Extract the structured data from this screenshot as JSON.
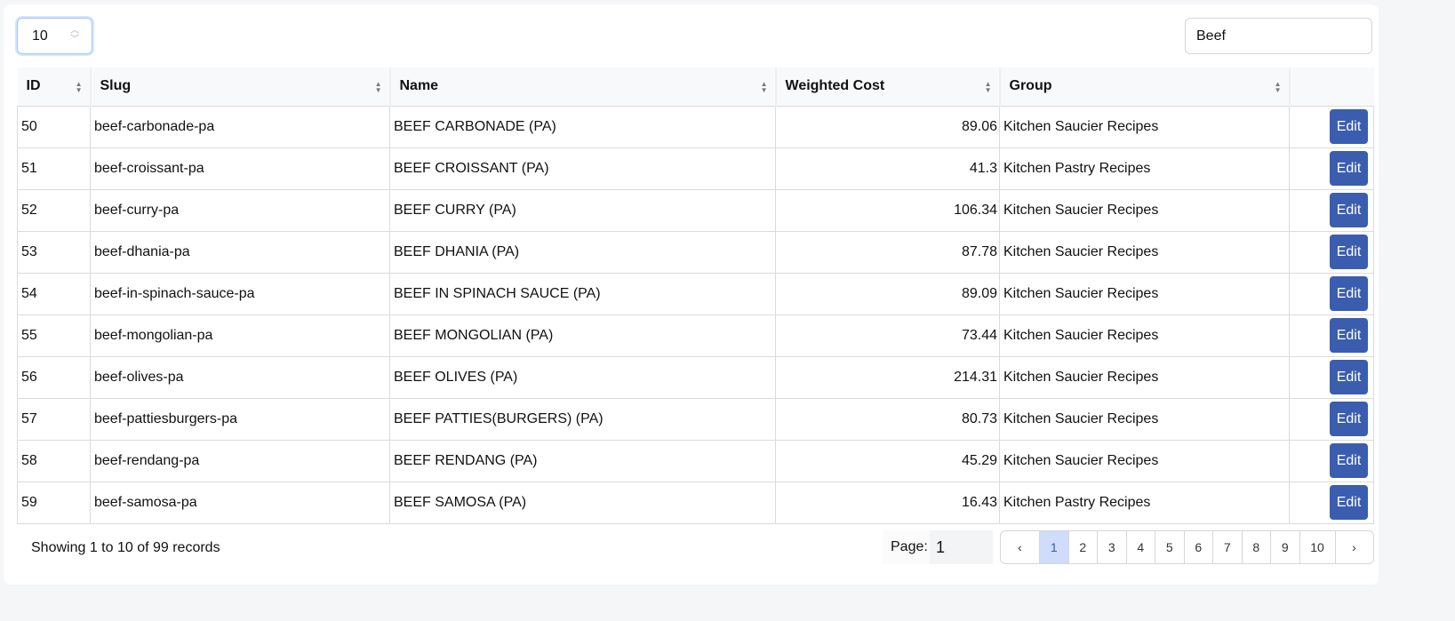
{
  "controls": {
    "per_page": "10",
    "search_value": "Beef"
  },
  "table": {
    "columns": [
      "ID",
      "Slug",
      "Name",
      "Weighted Cost",
      "Group",
      ""
    ],
    "rows": [
      {
        "id": "50",
        "slug": "beef-carbonade-pa",
        "name": "BEEF CARBONADE (PA)",
        "cost": "89.06",
        "group": "Kitchen Saucier Recipes"
      },
      {
        "id": "51",
        "slug": "beef-croissant-pa",
        "name": "BEEF CROISSANT (PA)",
        "cost": "41.3",
        "group": "Kitchen Pastry Recipes"
      },
      {
        "id": "52",
        "slug": "beef-curry-pa",
        "name": "BEEF CURRY (PA)",
        "cost": "106.34",
        "group": "Kitchen Saucier Recipes"
      },
      {
        "id": "53",
        "slug": "beef-dhania-pa",
        "name": "BEEF DHANIA (PA)",
        "cost": "87.78",
        "group": "Kitchen Saucier Recipes"
      },
      {
        "id": "54",
        "slug": "beef-in-spinach-sauce-pa",
        "name": "BEEF IN SPINACH SAUCE (PA)",
        "cost": "89.09",
        "group": "Kitchen Saucier Recipes"
      },
      {
        "id": "55",
        "slug": "beef-mongolian-pa",
        "name": "BEEF MONGOLIAN (PA)",
        "cost": "73.44",
        "group": "Kitchen Saucier Recipes"
      },
      {
        "id": "56",
        "slug": "beef-olives-pa",
        "name": "BEEF OLIVES (PA)",
        "cost": "214.31",
        "group": "Kitchen Saucier Recipes"
      },
      {
        "id": "57",
        "slug": "beef-pattiesburgers-pa",
        "name": "BEEF PATTIES(BURGERS) (PA)",
        "cost": "80.73",
        "group": "Kitchen Saucier Recipes"
      },
      {
        "id": "58",
        "slug": "beef-rendang-pa",
        "name": "BEEF RENDANG (PA)",
        "cost": "45.29",
        "group": "Kitchen Saucier Recipes"
      },
      {
        "id": "59",
        "slug": "beef-samosa-pa",
        "name": "BEEF SAMOSA (PA)",
        "cost": "16.43",
        "group": "Kitchen Pastry Recipes"
      }
    ],
    "edit_label": "Edit"
  },
  "footer": {
    "showing": "Showing 1 to 10 of 99 records",
    "page_label": "Page:",
    "page_value": "1",
    "prev": "‹",
    "next": "›",
    "pages": [
      "1",
      "2",
      "3",
      "4",
      "5",
      "6",
      "7",
      "8",
      "9",
      "10"
    ],
    "active_page": "1"
  },
  "colors": {
    "accent": "#3a5daf",
    "active_page_bg": "#cfdcfb"
  }
}
